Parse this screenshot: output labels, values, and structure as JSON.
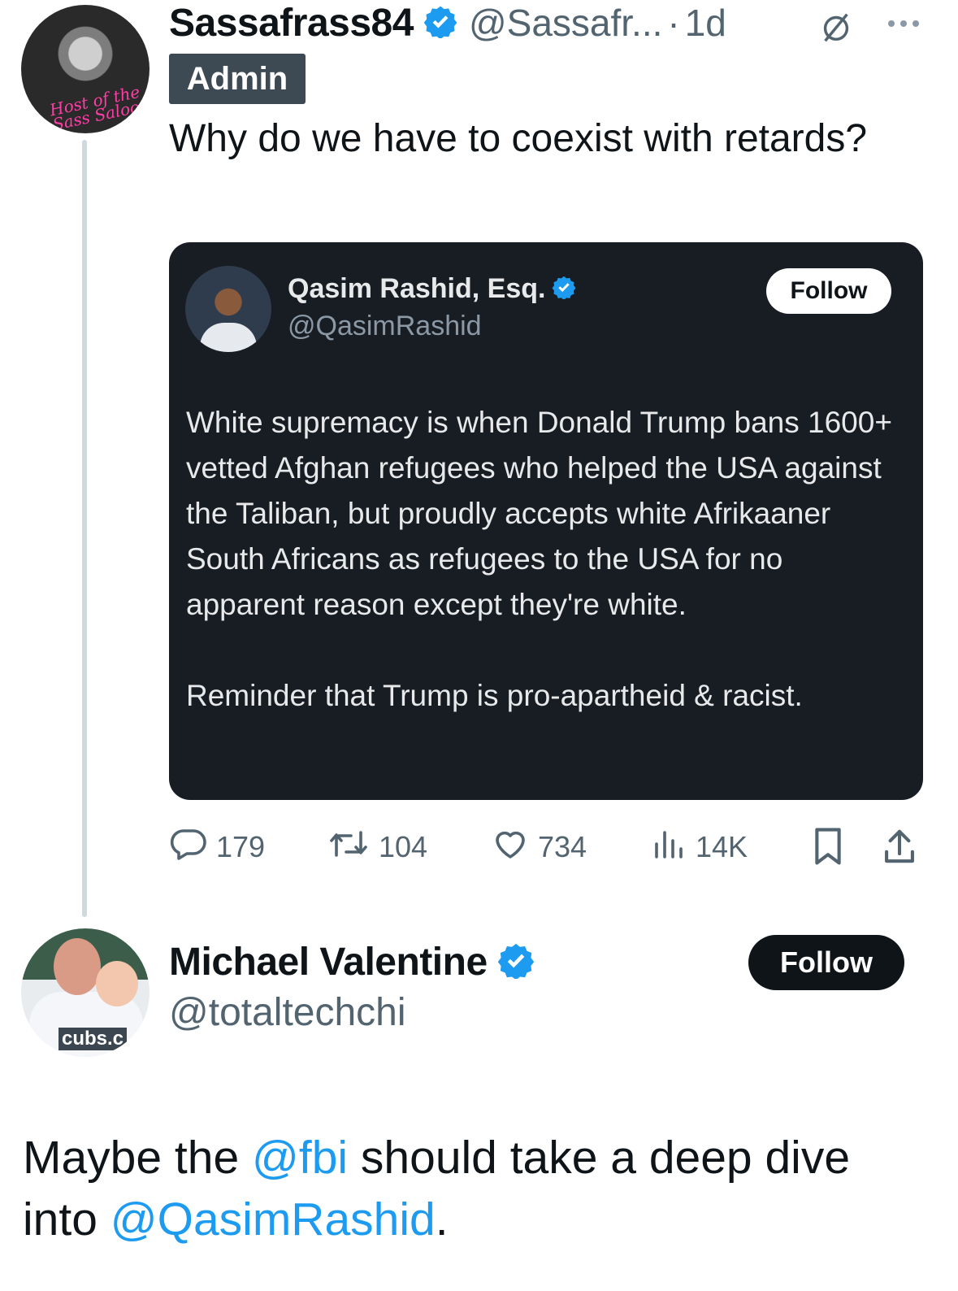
{
  "tweet": {
    "author_name": "Sassafrass84",
    "author_handle": "@Sassafr...",
    "separator": "·",
    "time": "1d",
    "badge": "Admin",
    "avatar_text": "Host of the\nSass Saloon",
    "text": "Why do we have to coexist with retards?",
    "icons": {
      "verified": "verified-badge-icon",
      "no_replies": "no-replies-icon",
      "more": "more-icon"
    },
    "quote": {
      "author_name": "Qasim Rashid, Esq.",
      "author_handle": "@QasimRashid",
      "follow_label": "Follow",
      "paragraph1": "White supremacy is when Donald Trump bans 1600+ vetted Afghan refugees who helped the USA against the Taliban, but proudly accepts white Afrikaaner South Africans as refugees to the USA for no apparent reason except they're white.",
      "paragraph2": "Reminder that Trump is pro-apartheid & racist."
    },
    "actions": {
      "replies": "179",
      "retweets": "104",
      "likes": "734",
      "views": "14K"
    }
  },
  "reply": {
    "author_name": "Michael Valentine",
    "author_handle": "@totaltechchi",
    "follow_label": "Follow",
    "avatar_text": "cubs.c",
    "text_parts": {
      "t1": "Maybe the ",
      "m1": "@fbi",
      "t2": " should take a deep dive into ",
      "m2": "@QasimRashid",
      "t3": "."
    }
  },
  "colors": {
    "verified": "#1d9bf0",
    "mention": "#1d9bf0",
    "muted": "#536471",
    "card_bg": "#181c23",
    "badge_bg": "#3d4a53"
  }
}
